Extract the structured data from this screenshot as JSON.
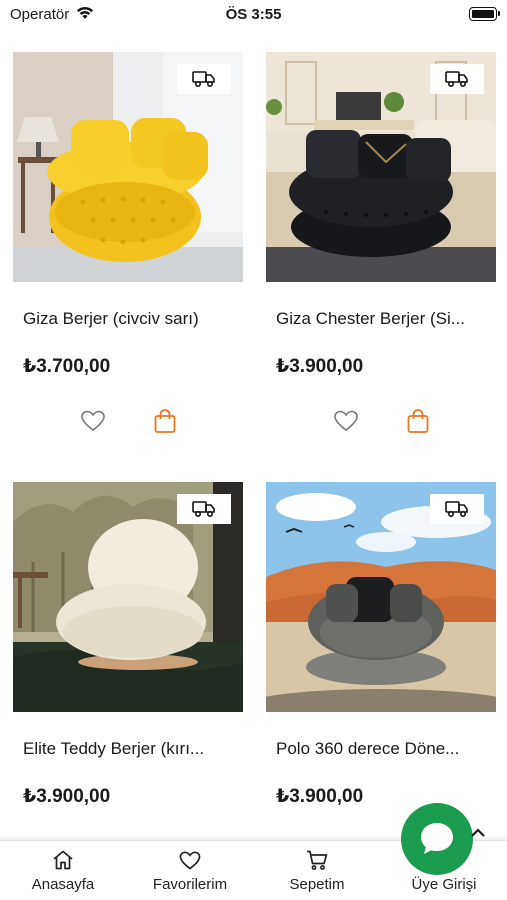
{
  "status_bar": {
    "carrier": "Operatör",
    "time": "ÖS 3:55"
  },
  "products": [
    {
      "name": "Giza Berjer (civciv sarı)",
      "price": "₺3.700,00"
    },
    {
      "name": "Giza Chester Berjer (Si...",
      "price": "₺3.900,00"
    },
    {
      "name": "Elite Teddy Berjer (kırı...",
      "price": "₺3.900,00"
    },
    {
      "name": "Polo 360 derece Döne...",
      "price": "₺3.900,00"
    }
  ],
  "bottom_nav": [
    {
      "label": "Anasayfa",
      "icon": "home-icon"
    },
    {
      "label": "Favorilerim",
      "icon": "heart-icon"
    },
    {
      "label": "Sepetim",
      "icon": "cart-icon"
    },
    {
      "label": "Üye Girişi",
      "icon": "user-icon"
    }
  ],
  "colors": {
    "accent": "#e87722",
    "chat": "#1a9b50",
    "text": "#1a1a1a"
  }
}
